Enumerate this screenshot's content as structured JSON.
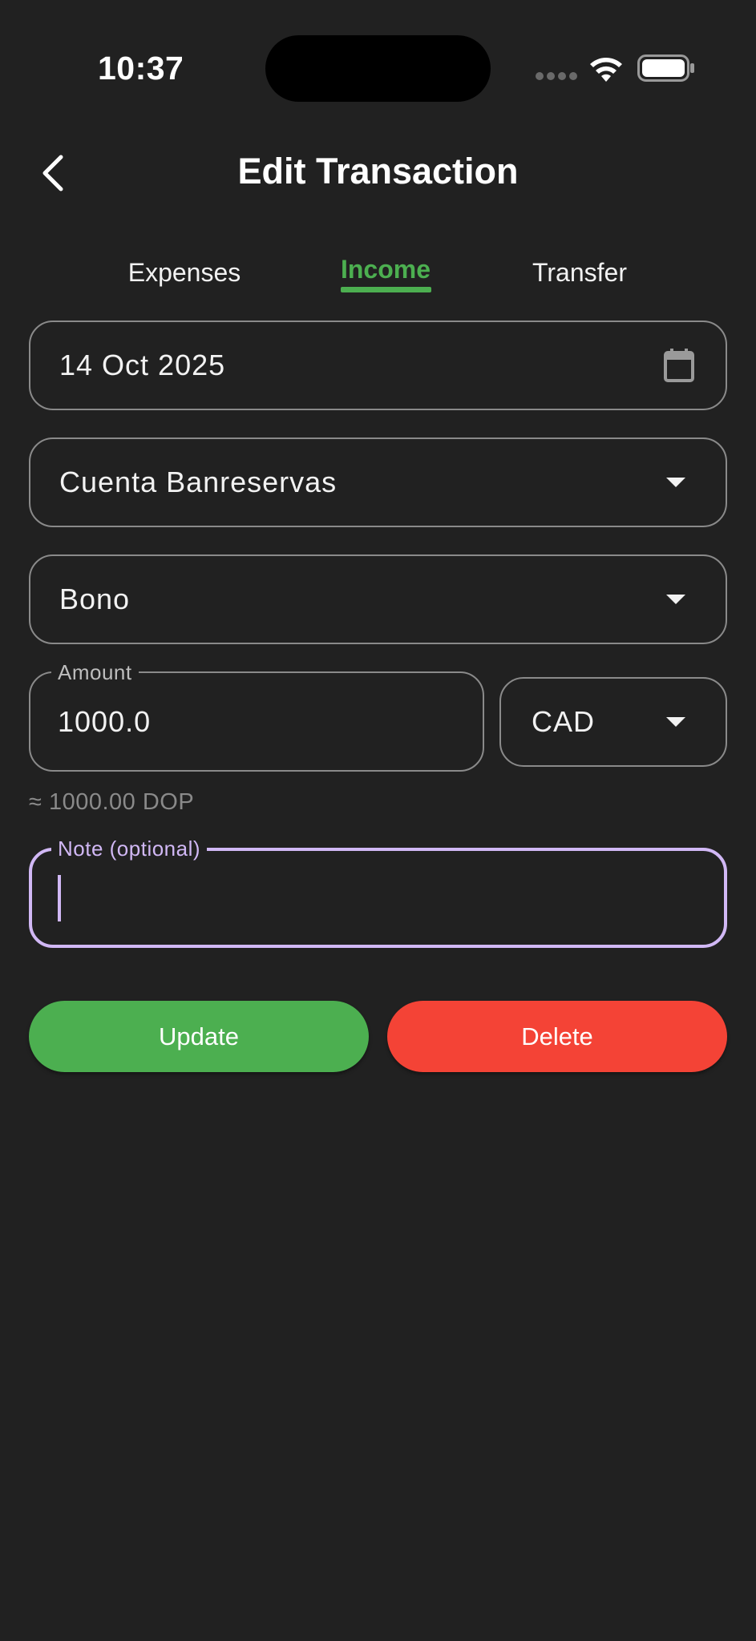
{
  "status_bar": {
    "time": "10:37"
  },
  "header": {
    "title": "Edit Transaction",
    "back_icon": "chevron-left-icon"
  },
  "tabs": [
    {
      "label": "Expenses",
      "active": false
    },
    {
      "label": "Income",
      "active": true
    },
    {
      "label": "Transfer",
      "active": false
    }
  ],
  "form": {
    "date": {
      "value": "14 Oct 2025",
      "icon": "calendar-icon"
    },
    "account": {
      "value": "Cuenta Banreservas"
    },
    "category": {
      "value": "Bono"
    },
    "amount": {
      "label": "Amount",
      "value": "1000.0"
    },
    "currency": {
      "value": "CAD"
    },
    "conversion": "≈ 1000.00 DOP",
    "note": {
      "label": "Note (optional)",
      "value": ""
    }
  },
  "actions": {
    "update_label": "Update",
    "delete_label": "Delete"
  },
  "colors": {
    "background": "#212121",
    "accent_green": "#4caf50",
    "delete_red": "#f44336",
    "focus_purple": "#d1b8f5",
    "outline": "#8a8a8a"
  }
}
